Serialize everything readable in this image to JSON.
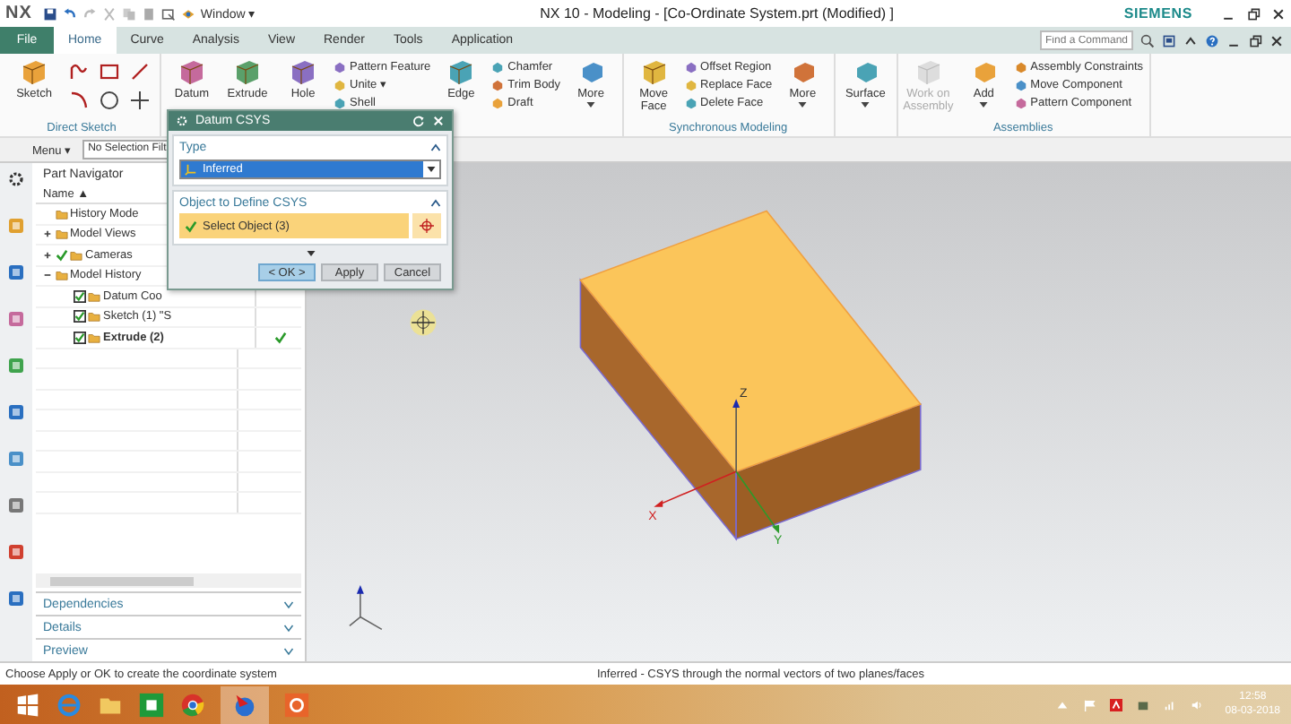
{
  "title_bar": {
    "logo": "NX",
    "window_menu": "Window ▾",
    "title": "NX 10 - Modeling - [Co-Ordinate System.prt (Modified) ]",
    "brand": "SIEMENS"
  },
  "ribbon_tabs": [
    {
      "label": "File",
      "kind": "file",
      "selected": false
    },
    {
      "label": "Home",
      "kind": "tab",
      "selected": true
    },
    {
      "label": "Curve",
      "kind": "tab",
      "selected": false
    },
    {
      "label": "Analysis",
      "kind": "tab",
      "selected": false
    },
    {
      "label": "View",
      "kind": "tab",
      "selected": false
    },
    {
      "label": "Render",
      "kind": "tab",
      "selected": false
    },
    {
      "label": "Tools",
      "kind": "tab",
      "selected": false
    },
    {
      "label": "Application",
      "kind": "tab",
      "selected": false
    }
  ],
  "command_search": {
    "placeholder": "Find a Command"
  },
  "ribbon_groups": [
    {
      "label": "Direct Sketch",
      "items": [
        {
          "kind": "large",
          "label": "Sketch",
          "disabled": false
        },
        {
          "kind": "sketch-tools"
        }
      ]
    },
    {
      "items": [
        {
          "kind": "large",
          "label": "Datum",
          "disabled": false
        },
        {
          "kind": "large",
          "label": "Extrude",
          "disabled": false
        },
        {
          "kind": "large",
          "label": "Hole",
          "disabled": false
        },
        {
          "kind": "stack",
          "labels": [
            "Pattern Feature",
            "Unite ▾",
            "Shell"
          ]
        },
        {
          "kind": "large",
          "label": "Edge",
          "disabled": false
        },
        {
          "kind": "stack",
          "labels": [
            "Chamfer",
            "Trim Body",
            "Draft"
          ]
        },
        {
          "kind": "more",
          "label": "More"
        }
      ]
    },
    {
      "label": "Synchronous Modeling",
      "items": [
        {
          "kind": "large",
          "label": "Move Face",
          "disabled": false
        },
        {
          "kind": "stack",
          "labels": [
            "Offset Region",
            "Replace Face",
            "Delete Face"
          ]
        },
        {
          "kind": "more",
          "label": "More"
        }
      ]
    },
    {
      "items": [
        {
          "kind": "more",
          "label": "Surface"
        }
      ]
    },
    {
      "label": "Assemblies",
      "items": [
        {
          "kind": "large",
          "label": "Work on Assembly",
          "disabled": true
        },
        {
          "kind": "more",
          "label": "Add"
        },
        {
          "kind": "stack",
          "labels": [
            "Assembly Constraints",
            "Move Component",
            "Pattern Component"
          ]
        }
      ]
    }
  ],
  "toolbar": {
    "menu": "Menu ▾",
    "selection_filter": "No Selection Filt"
  },
  "part_navigator": {
    "title": "Part Navigator",
    "column_1": "Name ▲",
    "tree": [
      {
        "label": "History Mode",
        "kind": "plain",
        "current": false
      },
      {
        "label": "Model Views",
        "kind": "plain",
        "expanded": false,
        "current": false
      },
      {
        "label": "Cameras",
        "kind": "tick",
        "checked": true,
        "expanded": false,
        "current": false
      },
      {
        "label": "Model History",
        "kind": "plain",
        "expanded": true,
        "current": false,
        "children": [
          {
            "label": "Datum Coo",
            "kind": "checkbox",
            "checked": true,
            "current": false
          },
          {
            "label": "Sketch (1) \"S",
            "kind": "checkbox",
            "checked": true,
            "current": false
          },
          {
            "label": "Extrude (2)",
            "kind": "checkbox",
            "checked": true,
            "current": true
          }
        ]
      }
    ],
    "panels": [
      "Dependencies",
      "Details",
      "Preview"
    ]
  },
  "dialog": {
    "title": "Datum CSYS",
    "type_section": {
      "label": "Type",
      "expanded": true
    },
    "type_value": "Inferred",
    "object_section": {
      "label": "Object to Define CSYS",
      "expanded": true
    },
    "select_label": "Select Object (3)",
    "select_done": true,
    "buttons": [
      {
        "label": "< OK >",
        "kind": "default"
      },
      {
        "label": "Apply",
        "kind": "normal"
      },
      {
        "label": "Cancel",
        "kind": "normal"
      }
    ]
  },
  "viewport": {
    "axis_labels": [
      "X",
      "Y",
      "Z"
    ]
  },
  "status_bar": {
    "prompt": "Choose Apply or OK to create the coordinate system",
    "message": "Inferred - CSYS through the normal vectors of two planes/faces"
  },
  "taskbar": {
    "time": "12:58",
    "date": "08-03-2018"
  }
}
